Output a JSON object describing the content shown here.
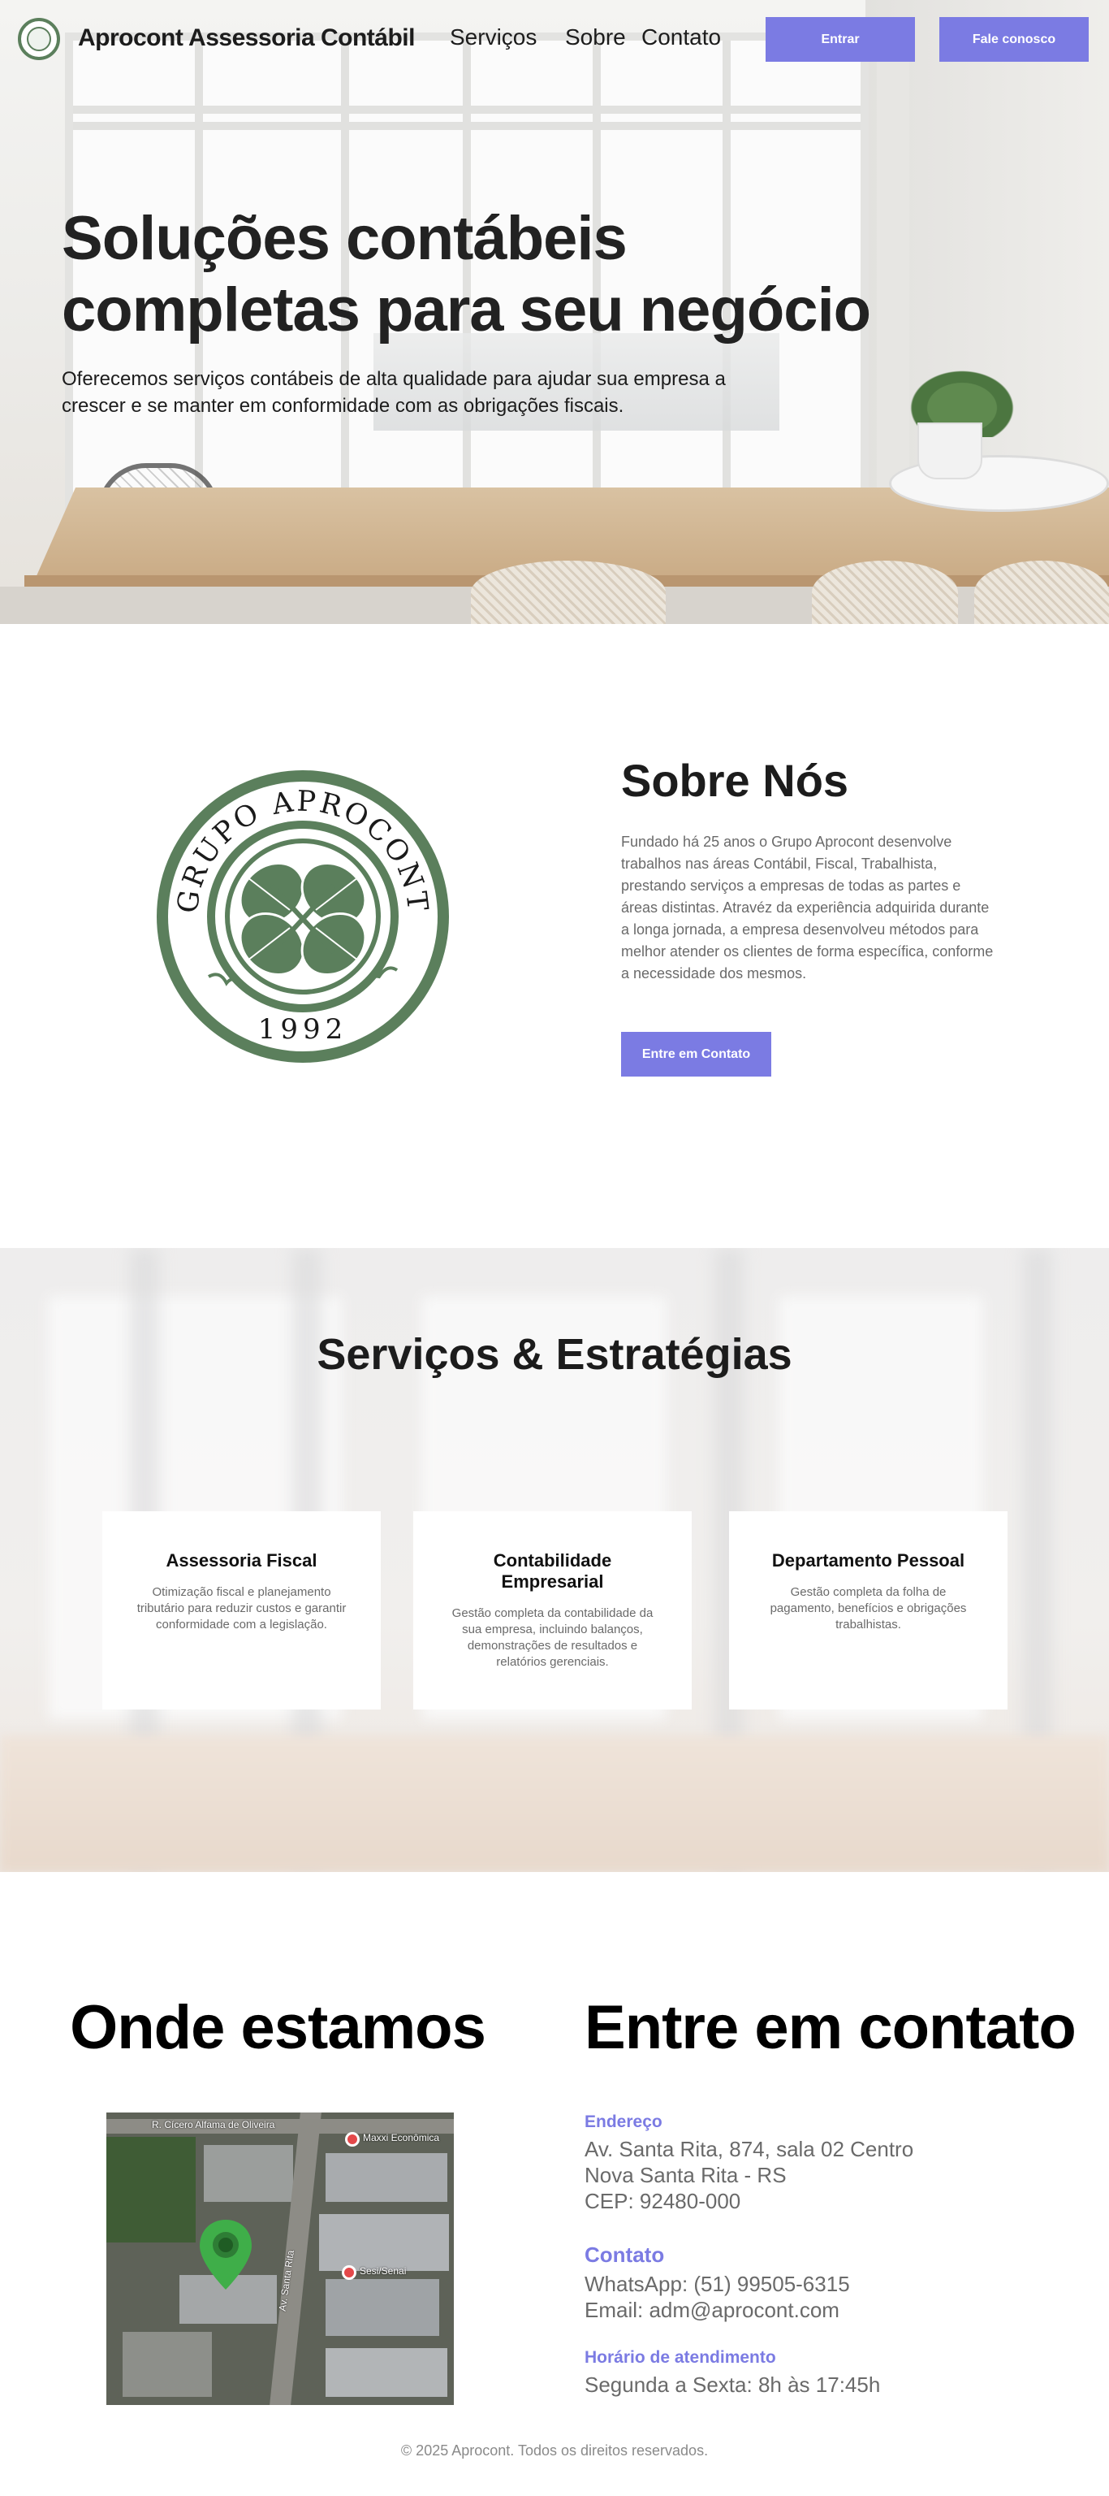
{
  "header": {
    "brand": "Aprocont Assessoria Contábil",
    "nav": [
      "Serviços",
      "Sobre",
      "Contato"
    ],
    "login_label": "Entrar",
    "cta_label": "Fale conosco"
  },
  "hero": {
    "title": "Soluções contábeis completas para seu negócio",
    "subtitle": "Oferecemos serviços contábeis de alta qualidade para ajudar sua empresa a crescer e se manter em conformidade com as obrigações fiscais."
  },
  "about": {
    "seal_text": "GRUPO APROCONT",
    "seal_year": "1992",
    "title": "Sobre Nós",
    "text": "Fundado há 25 anos o Grupo Aprocont desenvolve trabalhos nas áreas Contábil, Fiscal, Trabalhista, prestando serviços a empresas de todas as partes e áreas distintas. Atravéz da experiência adquirida durante a longa jornada, a empresa desenvolveu métodos para melhor atender os clientes de forma específica, conforme a necessidade dos mesmos.",
    "button_label": "Entre em Contato"
  },
  "services": {
    "title": "Serviços & Estratégias",
    "cards": [
      {
        "title": "Assessoria Fiscal",
        "text": "Otimização fiscal e planejamento tributário para reduzir custos e garantir conformidade com a legislação."
      },
      {
        "title": "Contabilidade Empresarial",
        "text": "Gestão completa da contabilidade da sua empresa, incluindo balanços, demonstrações de resultados e relatórios gerenciais."
      },
      {
        "title": "Departamento Pessoal",
        "text": "Gestão completa da folha de pagamento, benefícios e obrigações trabalhistas."
      }
    ]
  },
  "location": {
    "title": "Onde estamos",
    "map_labels": {
      "street_top": "R. Cícero Alfama de Oliveira",
      "street_side": "Av. Santa Rita",
      "poi_1": "Maxxi Econômica",
      "poi_2": "Sesi/Senai"
    }
  },
  "contact": {
    "title": "Entre em contato",
    "address_label": "Endereço",
    "address_lines": [
      "Av. Santa Rita, 874, sala 02 Centro",
      "Nova Santa Rita - RS",
      "CEP: 92480-000"
    ],
    "contact_label": "Contato",
    "contact_lines": [
      "WhatsApp: (51) 99505-6315",
      "Email: adm@aprocont.com"
    ],
    "hours_label": "Horário de atendimento",
    "hours_line": "Segunda a Sexta: 8h às 17:45h"
  },
  "footer": {
    "copyright": "© 2025 Aprocont. Todos os direitos reservados."
  },
  "colors": {
    "accent": "#7b7be3",
    "brand_green": "#5b7f5c",
    "text_dark": "#1c1c1c",
    "text_muted": "#6a6a6a"
  },
  "icons": {
    "logo": "clover-seal-icon",
    "map_pin": "map-pin-icon"
  }
}
